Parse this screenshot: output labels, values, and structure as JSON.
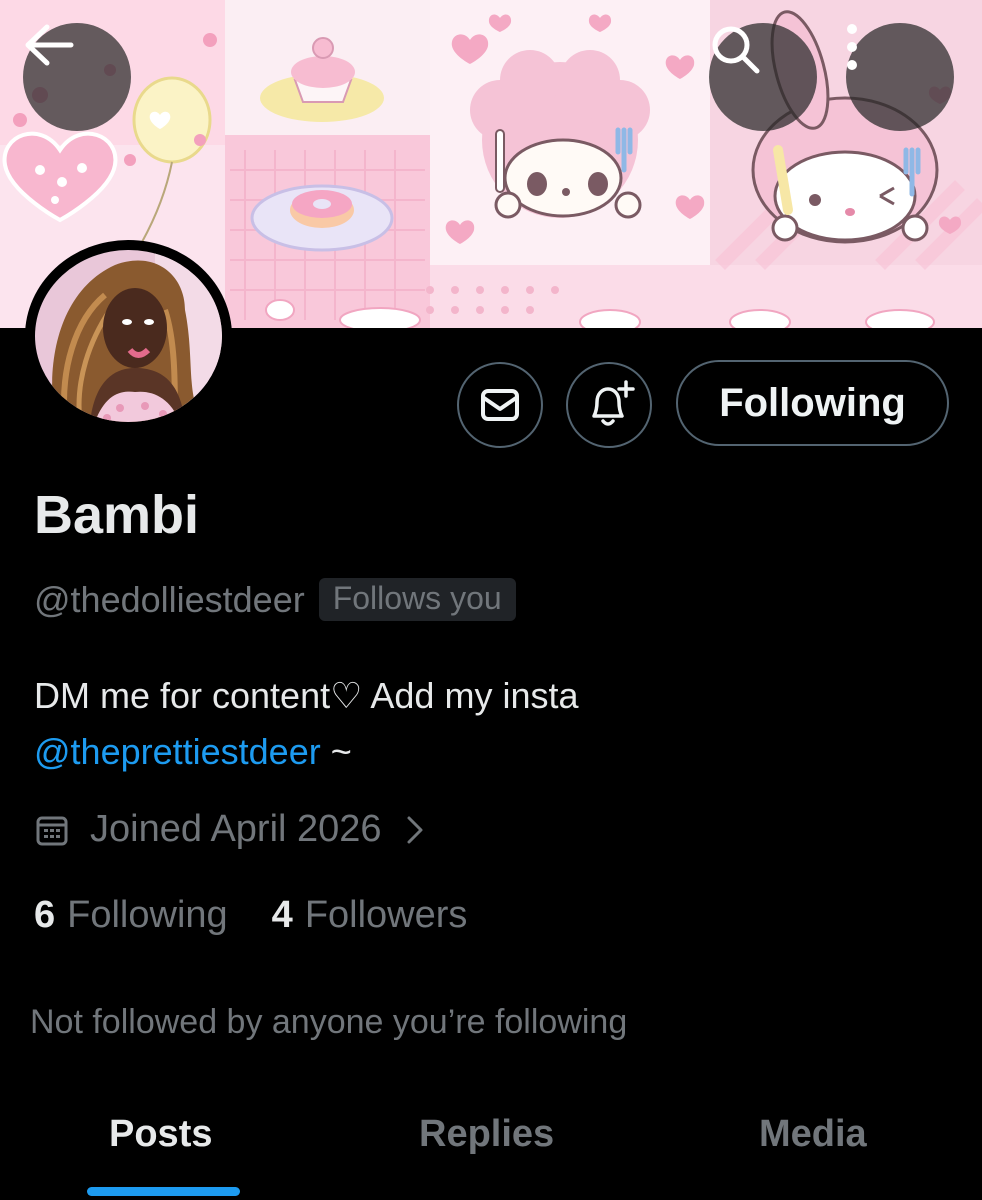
{
  "profile": {
    "name": "Bambi",
    "handle": "@thedolliestdeer",
    "follows_you_badge": "Follows you",
    "bio_text": "DM me for content♡ Add my insta",
    "bio_link": "@theprettiestdeer",
    "bio_suffix": " ~",
    "joined": "Joined April 2026",
    "following_count": "6",
    "following_label": "Following",
    "followers_count": "4",
    "followers_label": "Followers",
    "mutuals_note": "Not followed by anyone you’re following"
  },
  "actions": {
    "following_button": "Following"
  },
  "tabs": [
    {
      "label": "Posts",
      "active": true
    },
    {
      "label": "Replies",
      "active": false
    },
    {
      "label": "Media",
      "active": false
    }
  ],
  "icons": {
    "back": "arrow-left-icon",
    "search": "search-icon",
    "more": "more-vertical-icon",
    "message": "envelope-icon",
    "notify": "bell-plus-icon",
    "calendar": "calendar-icon",
    "chevron": "chevron-right-icon"
  },
  "colors": {
    "accent": "#1d9bf0",
    "muted": "#71767b",
    "text": "#e7e9ea",
    "border": "#536471"
  }
}
